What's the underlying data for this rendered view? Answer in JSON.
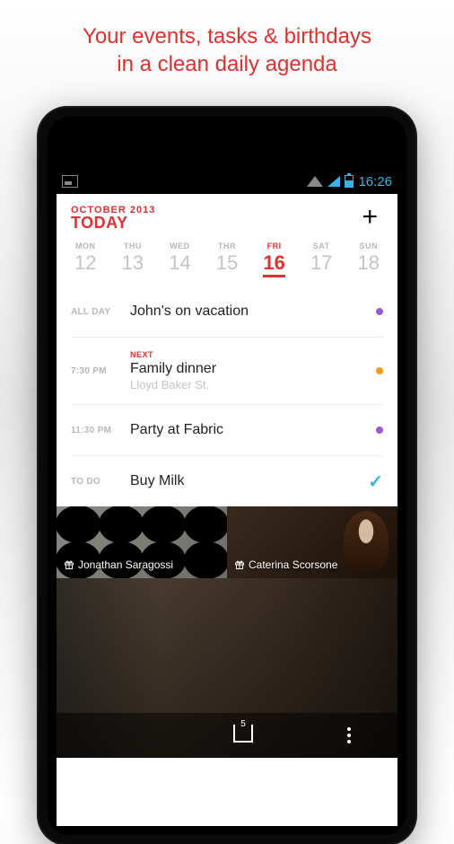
{
  "promo": {
    "line1": "Your events, tasks & birthdays",
    "line2": "in a clean daily agenda"
  },
  "status": {
    "time": "16:26"
  },
  "header": {
    "month": "OCTOBER 2013",
    "today_label": "TODAY",
    "add_symbol": "+"
  },
  "week": [
    {
      "dow": "MON",
      "num": "12",
      "selected": false
    },
    {
      "dow": "THU",
      "num": "13",
      "selected": false
    },
    {
      "dow": "WED",
      "num": "14",
      "selected": false
    },
    {
      "dow": "THR",
      "num": "15",
      "selected": false
    },
    {
      "dow": "FRI",
      "num": "16",
      "selected": true
    },
    {
      "dow": "SAT",
      "num": "17",
      "selected": false
    },
    {
      "dow": "SUN",
      "num": "18",
      "selected": false
    }
  ],
  "events": [
    {
      "time": "ALL DAY",
      "tag": "",
      "title": "John's on vacation",
      "sub": "",
      "dot": "#9b59d0",
      "check": false
    },
    {
      "time": "7:30 PM",
      "tag": "NEXT",
      "title": "Family dinner",
      "sub": "Lloyd Baker St.",
      "dot": "#f39c12",
      "check": false
    },
    {
      "time": "11:30 PM",
      "tag": "",
      "title": "Party at Fabric",
      "sub": "",
      "dot": "#9b59d0",
      "check": false
    },
    {
      "time": "TO DO",
      "tag": "",
      "title": "Buy Milk",
      "sub": "",
      "dot": "",
      "check": true
    }
  ],
  "birthdays": [
    {
      "name": "Jonathan Saragossi"
    },
    {
      "name": "Caterina Scorsone"
    }
  ],
  "nav": {
    "recent_count": "5"
  }
}
